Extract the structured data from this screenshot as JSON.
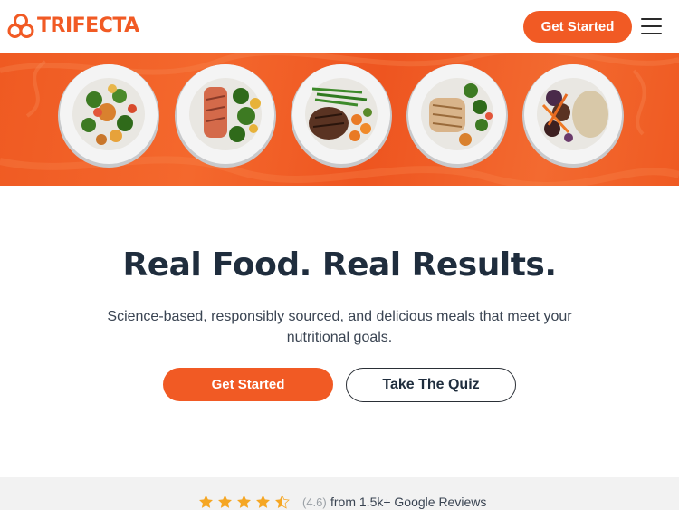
{
  "brand": {
    "name": "TRIFECTA",
    "color": "#f15a24"
  },
  "header": {
    "cta_label": "Get Started",
    "menu_icon": "hamburger-menu-icon"
  },
  "banner": {
    "background_color": "#ef5a22",
    "plates": [
      "plate-shrimp-stirfry",
      "plate-salmon-broccoli",
      "plate-steak-greenbeans",
      "plate-chicken-vegetables",
      "plate-beef-rice"
    ]
  },
  "hero": {
    "title": "Real Food. Real Results.",
    "subtitle": "Science-based, responsibly sourced, and delicious meals that meet your nutritional goals.",
    "primary_cta": "Get Started",
    "secondary_cta": "Take The Quiz"
  },
  "reviews": {
    "stars": 4.5,
    "rating_label": "(4.6)",
    "text": "from 1.5k+ Google Reviews",
    "star_color": "#f5a623"
  }
}
